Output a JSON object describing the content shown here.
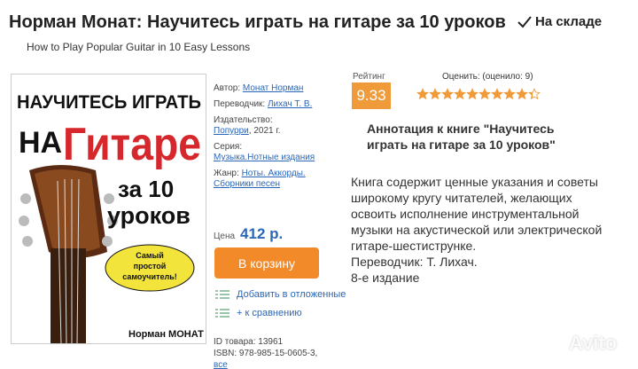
{
  "product": {
    "title": "Норман Монат: Научитесь играть на гитаре за 10 уроков",
    "subtitle": "How to Play Popular Guitar in 10 Easy Lessons",
    "stock": "На складе"
  },
  "cover": {
    "line1": "НАУЧИТЕСЬ ИГРАТЬ",
    "line2": "НА",
    "line3": "Гитаре",
    "line4": "за 10",
    "line5": "уроков",
    "badge1": "Самый",
    "badge2": "простой",
    "badge3": "самоучитель!",
    "author": "Норман МОНАТ",
    "colors": {
      "red": "#d6282c",
      "bg": "#ffffff"
    }
  },
  "details": {
    "author_label": "Автор:",
    "author": "Монат Норман",
    "translator_label": "Переводчик:",
    "translator": "Лихач Т. В.",
    "publisher_label": "Издательство:",
    "publisher": "Попурри",
    "year": ", 2021 г.",
    "series_label": "Серия:",
    "series": "Музыка.Нотные издания",
    "genre_label": "Жанр:",
    "genre": "Ноты. Аккорды. Сборники песен"
  },
  "purchase": {
    "price_label": "Цена",
    "price": "412 р.",
    "cart_button": "В корзину",
    "wishlist": "Добавить в отложенные",
    "compare": "+ к сравнению"
  },
  "ids": {
    "id_label": "ID товара:",
    "id": "13961",
    "isbn_label": "ISBN:",
    "isbn": "978-985-15-0605-3,",
    "isbn_more": "все"
  },
  "rating": {
    "label": "Рейтинг",
    "value": "9.33",
    "rate_label": "Оценить: (оценило: 9)",
    "stars_filled": 9.33,
    "stars_total": 10,
    "star_color": "#f09b3a"
  },
  "annotation": {
    "title": "Аннотация к книге \"Научитесь играть на гитаре за 10 уроков\"",
    "text": "Книга содержит ценные указания и советы широкому кругу читателей, желающих освоить исполнение инструментальной музыки на акустической или электрической гитаре-шестиструнке.",
    "translator": "Переводчик: Т. Лихач.",
    "edition": "8-е издание"
  },
  "watermark": "Avito"
}
